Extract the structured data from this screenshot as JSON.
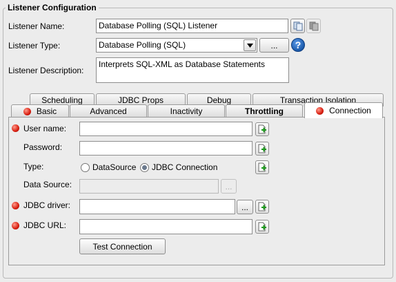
{
  "window": {
    "legend": "Listener Configuration"
  },
  "form": {
    "name_label": "Listener Name:",
    "name_value": "Database Polling (SQL) Listener",
    "type_label": "Listener Type:",
    "type_value": "Database Polling (SQL)",
    "type_browse": "...",
    "help_icon": "?",
    "desc_label": "Listener Description:",
    "desc_value": "Interprets SQL-XML as Database Statements"
  },
  "tabs": {
    "row_back": [
      "Scheduling",
      "JDBC Props",
      "Debug",
      "Transaction Isolation"
    ],
    "row_front": [
      "Basic",
      "Advanced",
      "Inactivity",
      "Throttling",
      "Connection"
    ],
    "selected": "Connection"
  },
  "connection": {
    "username_label": "User name:",
    "username_value": "",
    "password_label": "Password:",
    "password_value": "",
    "type_label": "Type:",
    "type_opt_datasource": "DataSource",
    "type_opt_jdbc": "JDBC Connection",
    "type_selected": "JDBC Connection",
    "datasource_label": "Data Source:",
    "datasource_browse": "...",
    "driver_label": "JDBC driver:",
    "driver_value": "",
    "driver_browse": "...",
    "url_label": "JDBC URL:",
    "url_value": "",
    "test_button": "Test Connection"
  },
  "colors": {
    "required_marker": "#d81e10",
    "help_blue": "#1f5fb0"
  }
}
